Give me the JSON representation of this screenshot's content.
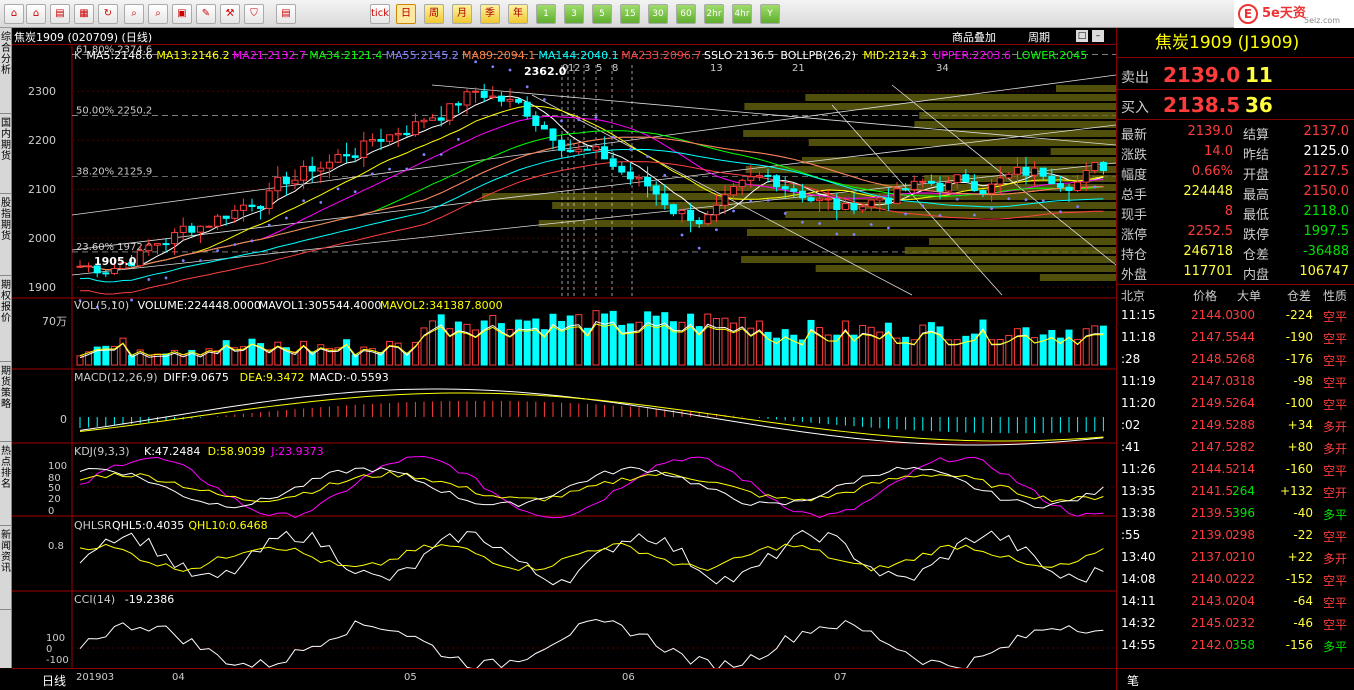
{
  "toolbar": {
    "buttons": [
      "",
      "",
      "",
      "",
      "",
      "",
      "",
      "",
      "",
      "",
      "",
      "",
      "tick",
      "日",
      "周",
      "月",
      "季",
      "年",
      "1",
      "3",
      "5",
      "15",
      "30",
      "60",
      "2hr",
      "4hr",
      "Y"
    ]
  },
  "brand": {
    "name": "5e天资",
    "sub": "5eiz.com",
    "logo": "E"
  },
  "left_tabs": [
    "综合分析",
    "国内期货",
    "股指期货",
    "期权报价",
    "期货策略",
    "热点排名",
    "新闻资讯"
  ],
  "header": {
    "title": "焦炭1909 (020709) (日线)",
    "btn_overlay": "商品叠加",
    "btn_period": "周期"
  },
  "main_chart": {
    "legend": [
      {
        "t": "K",
        "c": "#ccc"
      },
      {
        "t": "MA5:2148.6",
        "c": "#fff"
      },
      {
        "t": "MA13:2146.2",
        "c": "#ffff00"
      },
      {
        "t": "MA21:2132.7",
        "c": "#ff00ff"
      },
      {
        "t": "MA34:2121.4",
        "c": "#00ff00"
      },
      {
        "t": "MA55:2145.2",
        "c": "#8080ff"
      },
      {
        "t": "MA89:2094.1",
        "c": "#ff8040"
      },
      {
        "t": "MA144:2040.1",
        "c": "#00ffff"
      },
      {
        "t": "MA233:2096.7",
        "c": "#ff4040"
      },
      {
        "t": "SSLO 2136.5",
        "c": "#fff"
      },
      {
        "t": "BOLLPB(26,2)",
        "c": "#fff"
      },
      {
        "t": "MID:2124.3",
        "c": "#ffff00"
      },
      {
        "t": "UPPER:2203.6",
        "c": "#ff00ff"
      },
      {
        "t": "LOWER:2045",
        "c": "#00ff00"
      }
    ],
    "yticks": [
      "2300",
      "2200",
      "2100",
      "2000",
      "1900"
    ],
    "fibo": [
      "61.80% 2374.6",
      "50.00% 2250.2",
      "38.20% 2125.9",
      "23.60% 1972.0"
    ],
    "high_label": "2362.0",
    "low_label": "1905.0",
    "cycle_labels": [
      "0",
      "1",
      "2",
      "3",
      "5",
      "8",
      "13",
      "21",
      "34"
    ]
  },
  "vol": {
    "legend": [
      {
        "t": "VOL(5,10)",
        "c": "#ccc"
      },
      {
        "t": "VOLUME:224448.0000",
        "c": "#fff"
      },
      {
        "t": "MAVOL1:305544.4000",
        "c": "#fff"
      },
      {
        "t": "MAVOL2:341387.8000",
        "c": "#ffff00"
      }
    ],
    "ytick": "70万"
  },
  "macd": {
    "legend": [
      {
        "t": "MACD(12,26,9)",
        "c": "#ccc"
      },
      {
        "t": "DIFF:9.0675",
        "c": "#fff"
      },
      {
        "t": "DEA:9.3472",
        "c": "#ffff00"
      },
      {
        "t": "MACD:-0.5593",
        "c": "#fff"
      }
    ],
    "ytick": "0"
  },
  "kdj": {
    "legend": [
      {
        "t": "KDJ(9,3,3)",
        "c": "#ccc"
      },
      {
        "t": "K:47.2484",
        "c": "#fff"
      },
      {
        "t": "D:58.9039",
        "c": "#ffff00"
      },
      {
        "t": "J:23.9373",
        "c": "#ff00ff"
      }
    ],
    "yticks": [
      "100",
      "80",
      "50",
      "20",
      "0"
    ]
  },
  "qhlsr": {
    "legend": [
      {
        "t": "QHLSR",
        "c": "#ccc"
      },
      {
        "t": "QHL5:0.4035",
        "c": "#fff"
      },
      {
        "t": "QHL10:0.6468",
        "c": "#ffff00"
      }
    ],
    "ytick": "0.8"
  },
  "cci": {
    "legend": [
      {
        "t": "CCI(14)",
        "c": "#ccc"
      },
      {
        "t": "-19.2386",
        "c": "#fff"
      }
    ],
    "yticks": [
      "100",
      "0",
      "-100"
    ]
  },
  "xaxis": {
    "period": "日线",
    "labels": [
      "201903",
      "04",
      "05",
      "06",
      "07"
    ]
  },
  "panel": {
    "title": "焦炭1909 (J1909)",
    "sell": {
      "label": "卖出",
      "price": "2139.0",
      "vol": "11"
    },
    "buy": {
      "label": "买入",
      "price": "2138.5",
      "vol": "36"
    },
    "quote": [
      [
        "最新",
        "2139.0",
        "结算",
        "2137.0"
      ],
      [
        "涨跌",
        "14.0",
        "昨结",
        "2125.0"
      ],
      [
        "幅度",
        "0.66%",
        "开盘",
        "2127.5"
      ],
      [
        "总手",
        "224448",
        "最高",
        "2150.0"
      ],
      [
        "现手",
        "8",
        "最低",
        "2118.0"
      ],
      [
        "涨停",
        "2252.5",
        "跌停",
        "1997.5"
      ],
      [
        "持仓",
        "246718",
        "仓差",
        "-36488"
      ],
      [
        "外盘",
        "117701",
        "内盘",
        "106747"
      ]
    ],
    "tick_header": [
      "北京",
      "价格",
      "大单",
      "仓差",
      "性质"
    ],
    "ticks": [
      [
        "11:15",
        "2144.0",
        "300",
        "-224",
        "空平"
      ],
      [
        "11:18",
        "2147.5",
        "544",
        "-190",
        "空平"
      ],
      [
        ":28",
        "2148.5",
        "268",
        "-176",
        "空平"
      ],
      [
        "11:19",
        "2147.0",
        "318",
        "-98",
        "空平"
      ],
      [
        "11:20",
        "2149.5",
        "264",
        "-100",
        "空平"
      ],
      [
        ":02",
        "2149.5",
        "288",
        "+34",
        "多开"
      ],
      [
        ":41",
        "2147.5",
        "282",
        "+80",
        "多开"
      ],
      [
        "11:26",
        "2144.5",
        "214",
        "-160",
        "空平"
      ],
      [
        "13:35",
        "2141.5",
        "264",
        "+132",
        "空开"
      ],
      [
        "13:38",
        "2139.5",
        "396",
        "-40",
        "多平"
      ],
      [
        ":55",
        "2139.0",
        "298",
        "-22",
        "空平"
      ],
      [
        "13:40",
        "2137.0",
        "210",
        "+22",
        "多开"
      ],
      [
        "14:08",
        "2140.0",
        "222",
        "-152",
        "空平"
      ],
      [
        "14:11",
        "2143.0",
        "204",
        "-64",
        "空平"
      ],
      [
        "14:32",
        "2145.0",
        "232",
        "-46",
        "空平"
      ],
      [
        "14:55",
        "2142.0",
        "358",
        "-156",
        "多平"
      ]
    ],
    "bottom_tab": "笔"
  },
  "colors": {
    "up": "#ff3c3c",
    "down": "#00ffff",
    "grid": "#800000"
  }
}
